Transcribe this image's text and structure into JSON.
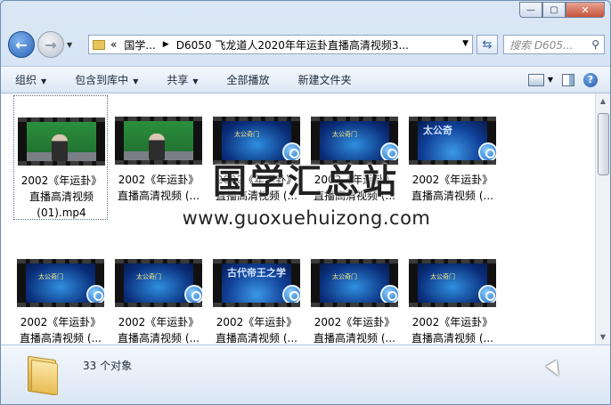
{
  "window": {
    "minimize_label": "—",
    "maximize_label": "▢",
    "close_label": "✕"
  },
  "nav": {
    "back_label": "←",
    "forward_label": "→",
    "recent_label": "▼"
  },
  "address": {
    "overflow": "«",
    "segments": [
      "国学...",
      "D6050 飞龙道人2020年年运卦直播高清视频3..."
    ],
    "separator": "▶",
    "dropdown": "▼",
    "refresh_label": "⇆"
  },
  "search": {
    "placeholder": "搜索 D605...",
    "icon": "magnifier-icon",
    "icon_glyph": "⚲"
  },
  "toolbar": {
    "organize": "组织",
    "include_library": "包含到库中",
    "share": "共享",
    "play_all": "全部播放",
    "new_folder": "新建文件夹",
    "dropdown_glyph": "▼",
    "help_label": "?"
  },
  "files": [
    {
      "line1": "2002《年运卦》",
      "line2": "直播高清视频",
      "line3": "(01).mp4",
      "scene": "green",
      "caption": ""
    },
    {
      "line1": "2002《年运卦》",
      "line2": "直播高清视频 (...",
      "line3": "",
      "scene": "green",
      "caption": ""
    },
    {
      "line1": "2002《年运卦》",
      "line2": "直播高清视频 (...",
      "line3": "",
      "scene": "blue",
      "caption": "太公奇门"
    },
    {
      "line1": "2002《年运卦》",
      "line2": "直播高清视频 (...",
      "line3": "",
      "scene": "blue",
      "caption": "太公奇门"
    },
    {
      "line1": "2002《年运卦》",
      "line2": "直播高清视频 (...",
      "line3": "",
      "scene": "blue2",
      "caption": "太公奇"
    },
    {
      "line1": "2002《年运卦》",
      "line2": "直播高清视频 (...",
      "line3": "",
      "scene": "blue",
      "caption": "太公奇门"
    },
    {
      "line1": "2002《年运卦》",
      "line2": "直播高清视频 (...",
      "line3": "",
      "scene": "blue",
      "caption": "太公奇门"
    },
    {
      "line1": "2002《年运卦》",
      "line2": "直播高清视频 (...",
      "line3": "",
      "scene": "blue2",
      "caption": "古代帝王之学"
    },
    {
      "line1": "2002《年运卦》",
      "line2": "直播高清视频 (...",
      "line3": "",
      "scene": "blue",
      "caption": "太公奇门"
    },
    {
      "line1": "2002《年运卦》",
      "line2": "直播高清视频 (...",
      "line3": "",
      "scene": "blue",
      "caption": "太公奇门"
    }
  ],
  "status": {
    "count": "33 个对象"
  },
  "watermark": {
    "title": "国学汇总站",
    "url": "www.guoxuehuizong.com"
  },
  "scrollbar": {
    "up": "▲",
    "down": "▼"
  },
  "colors": {
    "accent": "#2862b6",
    "frame": "#c4d6ec"
  }
}
